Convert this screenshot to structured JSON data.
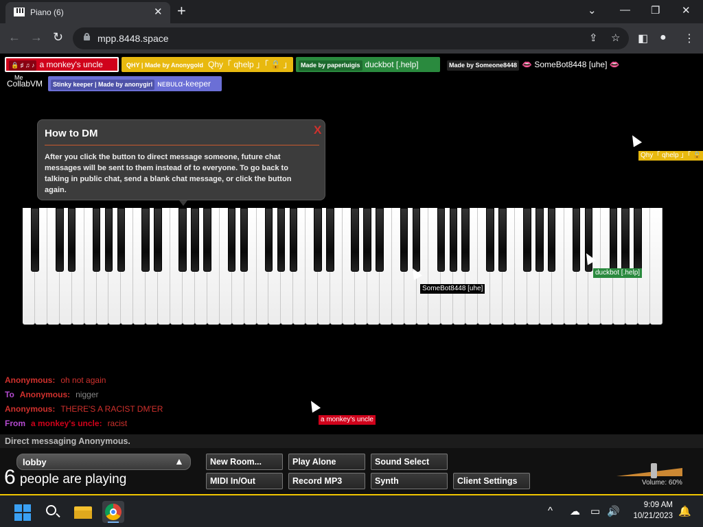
{
  "browser": {
    "tab_title": "Piano (6)",
    "tab_close": "✕",
    "new_tab": "+",
    "url": "mpp.8448.space"
  },
  "players": {
    "me": {
      "name": "a monkey's uncle",
      "label": "Me",
      "icons": "🔒 ♯ ♫ ♪",
      "color": "#d0021b"
    },
    "qhy": {
      "badge": "QHY | Made by Anonygold",
      "name": "Qhy「 qhelp 」「 🔒 」",
      "color": "#e8b90f"
    },
    "duckbot": {
      "badge": "Made by paperluigis",
      "name": "duckbot [.help]",
      "color": "#2a8a3e"
    },
    "somebot": {
      "badge": "Made by Someone8448",
      "name": "SomeBot8448 [uhe]",
      "color": "#111111"
    },
    "collab": {
      "name": "CollabVM"
    },
    "nebula": {
      "badge": "Stinky keeper | Made by anonygirl",
      "name": "ɴᴇʙᴜʟα-keeper",
      "color": "#6b6fd6"
    }
  },
  "tooltip": {
    "title": "How to DM",
    "close": "X",
    "body": "After you click the button to direct message someone, future chat messages will be sent to them instead of to everyone. To go back to talking in public chat, send a blank chat message, or click the button again."
  },
  "cursors": {
    "qhy_label": "Qhy「 qhelp 」「 🔒 」",
    "somebot_label": "SomeBot8448 [uhe]",
    "duckbot_label": "duckbot [.help]",
    "monkey_label": "a monkey's uncle"
  },
  "chat": [
    {
      "prefix": "",
      "name": "Anonymous:",
      "text": "oh not again",
      "name_color": "#d0312d",
      "text_color": "#d0312d"
    },
    {
      "prefix": "To",
      "name": "Anonymous:",
      "text": "nigger",
      "name_color": "#d0312d",
      "text_color": "#888888"
    },
    {
      "prefix": "",
      "name": "Anonymous:",
      "text": "THERE'S A RACIST DM'ER",
      "name_color": "#d0312d",
      "text_color": "#d0312d"
    },
    {
      "prefix": "From",
      "name": "a monkey's uncle:",
      "text": "racist",
      "name_color": "#d0021b",
      "text_color": "#d0312d"
    }
  ],
  "status": "Direct messaging Anonymous.",
  "room": {
    "name": "lobby",
    "count": "6",
    "count_label": "people are playing"
  },
  "buttons": {
    "new_room": "New Room...",
    "play_alone": "Play Alone",
    "sound_select": "Sound Select",
    "midi": "MIDI In/Out",
    "record": "Record MP3",
    "synth": "Synth",
    "client_settings": "Client Settings"
  },
  "volume": {
    "label": "Volume: 60%",
    "value": 60
  },
  "taskbar": {
    "time": "9:09 AM",
    "date": "10/21/2023"
  }
}
